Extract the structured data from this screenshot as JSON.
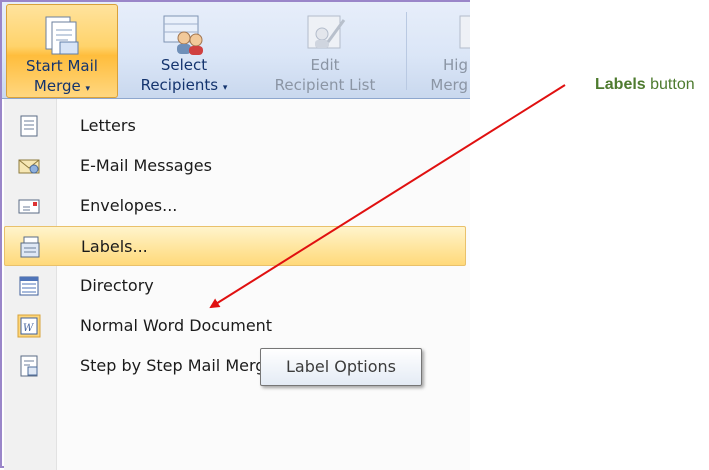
{
  "ribbon": {
    "start_mail_merge": {
      "line1": "Start Mail",
      "line2": "Merge",
      "caret": "▾"
    },
    "select_recipients": {
      "line1": "Select",
      "line2": "Recipients",
      "caret": "▾"
    },
    "edit_recipient_list": {
      "line1": "Edit",
      "line2": "Recipient List"
    },
    "highlight_merge": {
      "line1": "Hig",
      "line2": "Merg"
    }
  },
  "menu": {
    "items": [
      {
        "label": "Letters",
        "icon": "letter-icon"
      },
      {
        "label": "E-Mail Messages",
        "icon": "email-envelope-icon"
      },
      {
        "label": "Envelopes...",
        "icon": "envelope-icon"
      },
      {
        "label": "Labels...",
        "icon": "labels-icon",
        "highlighted": true
      },
      {
        "label": "Directory",
        "icon": "directory-icon"
      },
      {
        "label": "Normal Word Document",
        "icon": "word-document-icon"
      },
      {
        "label": "Step by Step Mail Merge Wizard...",
        "icon": "wizard-icon"
      }
    ]
  },
  "tooltip": {
    "text": "Label Options"
  },
  "callout": {
    "bold": "Labels",
    "rest": " button"
  },
  "colors": {
    "arrow": "#e01010",
    "callout": "#4e7b2f",
    "highlight": "#ffd97a",
    "frame": "#9a86c9"
  }
}
